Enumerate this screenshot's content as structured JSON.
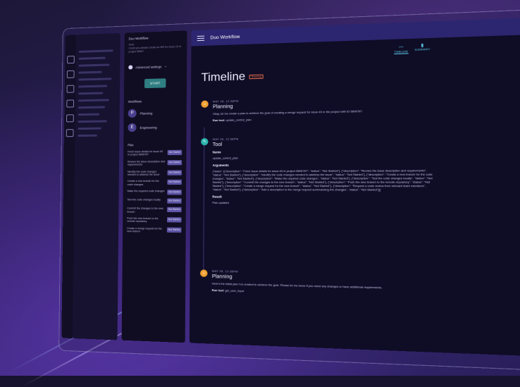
{
  "app": {
    "title": "Duo Workflow"
  },
  "sidebar": {
    "workflow_title": "Duo Workflow",
    "goal_label": "Goal",
    "goal_text": "Could you please create an MR for issue 10 in project 5806?",
    "advanced_settings": "Advanced settings",
    "start_button": "START",
    "workflows_heading": "Workflows",
    "workflows": [
      {
        "initial": "P",
        "label": "Planning"
      },
      {
        "initial": "E",
        "label": "Engineering"
      }
    ],
    "plan_heading": "Plan",
    "plan_items": [
      {
        "text": "Fetch issue details for issue #3 in project 5806787",
        "status": "Not Started"
      },
      {
        "text": "Review the issue description and requirements",
        "status": "Not Started"
      },
      {
        "text": "Identify the code changes needed to address the issue",
        "status": "Not Started"
      },
      {
        "text": "Create a new branch for the code changes",
        "status": "Not Started"
      },
      {
        "text": "Make the required code changes",
        "status": "Not Started"
      },
      {
        "text": "Test the code changes locally",
        "status": "Not Started"
      },
      {
        "text": "Commit the changes to the new branch",
        "status": "Not Started"
      },
      {
        "text": "Push the new branch to the remote repository",
        "status": "Not Started"
      },
      {
        "text": "Create a merge request for the new branch",
        "status": "Not Started"
      }
    ]
  },
  "tabs": [
    {
      "label": "TIMELINE",
      "icon": "line-chart-icon"
    },
    {
      "label": "SUMMARY",
      "icon": "bar-chart-icon"
    }
  ],
  "timeline": {
    "title": "Timeline",
    "status_badge": "Running",
    "entries": [
      {
        "date": "MAY 28, 12:38PM",
        "title": "Planning",
        "text": "Okay, let me create a plan to achieve the goal of creating a merge request for issue #3 in the project with ID 5806787.",
        "run_tool_label": "Run tool:",
        "run_tool_value": "update_control_plan",
        "color": "#f0a030"
      },
      {
        "date": "MAY 28, 12:38PM",
        "title": "Tool",
        "name_label": "Name",
        "name_value": "update_control_plan",
        "args_label": "Arguments",
        "args_text": "{\"tasks\": [{\"description\": \"Fetch issue details for issue #3 in project 5806787\", \"status\": \"Not Started\"}, {\"description\": \"Review the issue description and requirements\", \"status\": \"Not Started\"}, {\"description\": \"Identify the code changes needed to address the issue\", \"status\": \"Not Started\"}, {\"description\": \"Create a new branch for the code changes\", \"status\": \"Not Started\"}, {\"description\": \"Make the required code changes\", \"status\": \"Not Started\"}, {\"description\": \"Test the code changes locally\", \"status\": \"Not Started\"}, {\"description\": \"Commit the changes to the new branch\", \"status\": \"Not Started\"}, {\"description\": \"Push the new branch to the remote repository\", \"status\": \"Not Started\"}, {\"description\": \"Create a merge request for the new branch\", \"status\": \"Not Started\"}, {\"description\": \"Request a code review from relevant team members\", \"status\": \"Not Started\"}, {\"description\": \"Add a description to the merge request summarizing the changes\", \"status\": \"Not Started\"}]}",
        "result_label": "Result",
        "result_value": "Plan updated",
        "color": "#2fb5b0"
      },
      {
        "date": "MAY 28, 12:38PM",
        "title": "Planning",
        "text": "Here's the initial plan I've created to achieve the goal. Please let me know if you need any changes or have additional requirements.",
        "run_tool_label": "Run tool:",
        "run_tool_value": "get_user_input",
        "color": "#f0a030"
      }
    ]
  }
}
